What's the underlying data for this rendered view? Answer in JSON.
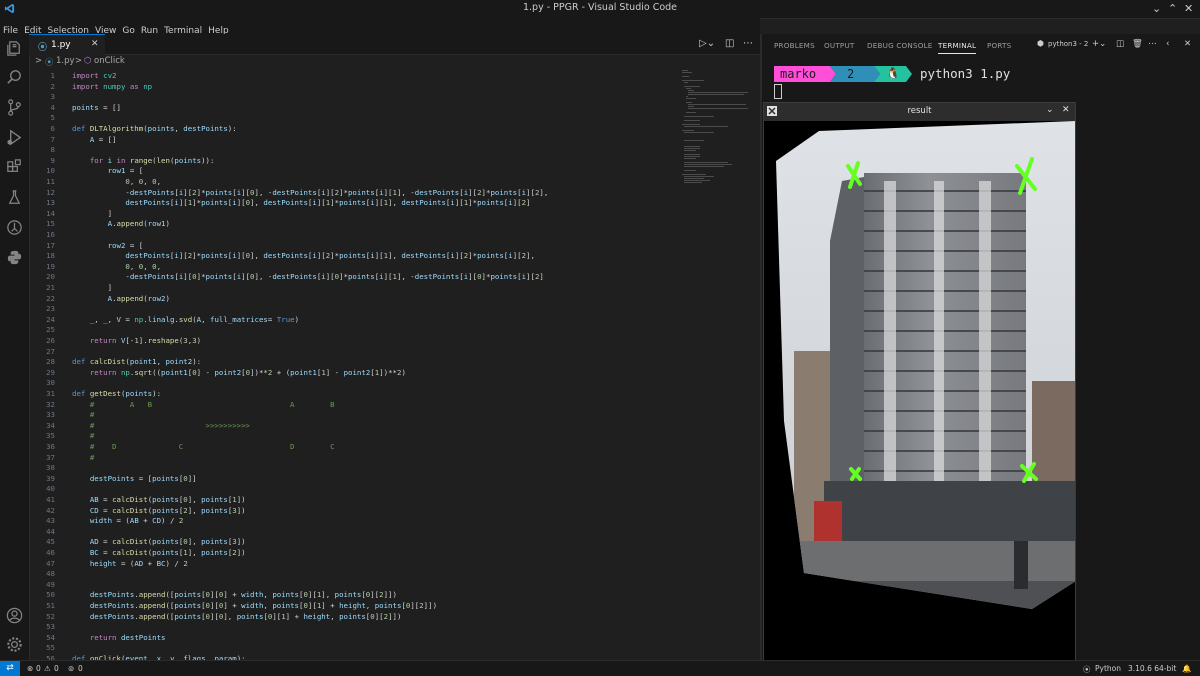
{
  "window": {
    "title": "1.py - PPGR - Visual Studio Code"
  },
  "menu": [
    "File",
    "Edit",
    "Selection",
    "View",
    "Go",
    "Run",
    "Terminal",
    "Help"
  ],
  "tab": {
    "name": "1.py",
    "icon_label": "",
    "close": "✕"
  },
  "breadcrumb": {
    "chevron": ">",
    "file": "1.py",
    "sep": ">",
    "symbol": "onClick"
  },
  "code": {
    "line_numbers": [
      "1",
      "2",
      "3",
      "4",
      "5",
      "6",
      "7",
      "8",
      "9",
      "10",
      "11",
      "12",
      "13",
      "14",
      "15",
      "16",
      "17",
      "18",
      "19",
      "20",
      "21",
      "22",
      "23",
      "24",
      "25",
      "26",
      "27",
      "28",
      "29",
      "30",
      "31",
      "32",
      "33",
      "34",
      "35",
      "36",
      "37",
      "38",
      "39",
      "40",
      "41",
      "42",
      "43",
      "44",
      "45",
      "46",
      "47",
      "48",
      "49",
      "50",
      "51",
      "52",
      "53",
      "54",
      "55",
      "56"
    ],
    "lines": [
      "import cv2",
      "import numpy as np",
      "",
      "points = []",
      "",
      "def DLTAlgorithm(points, destPoints):",
      "    A = []",
      "",
      "    for i in range(len(points)):",
      "        row1 = [",
      "            0, 0, 0,",
      "            -destPoints[i][2]*points[i][0], -destPoints[i][2]*points[i][1], -destPoints[i][2]*points[i][2],",
      "            destPoints[i][1]*points[i][0], destPoints[i][1]*points[i][1], destPoints[i][1]*points[i][2]",
      "        ]",
      "        A.append(row1)",
      "",
      "        row2 = [",
      "            destPoints[i][2]*points[i][0], destPoints[i][2]*points[i][1], destPoints[i][2]*points[i][2],",
      "            0, 0, 0,",
      "            -destPoints[i][0]*points[i][0], -destPoints[i][0]*points[i][1], -destPoints[i][0]*points[i][2]",
      "        ]",
      "        A.append(row2)",
      "",
      "    _, _, V = np.linalg.svd(A, full_matrices= True)",
      "",
      "    return V[-1].reshape(3,3)",
      "",
      "def calcDist(point1, point2):",
      "    return np.sqrt((point1[0] - point2[0])**2 + (point1[1] - point2[1])**2)",
      "",
      "def getDest(points):",
      "    #        A   B                               A        B",
      "    #",
      "    #                         >>>>>>>>>>",
      "    #",
      "    #    D              C                        D        C",
      "    #",
      "",
      "    destPoints = [points[0]]",
      "",
      "    AB = calcDist(points[0], points[1])",
      "    CD = calcDist(points[2], points[3])",
      "    width = (AB + CD) / 2",
      "",
      "    AD = calcDist(points[0], points[3])",
      "    BC = calcDist(points[1], points[2])",
      "    height = (AD + BC) / 2",
      "",
      "",
      "    destPoints.append([points[0][0] + width, points[0][1], points[0][2]])",
      "    destPoints.append([points[0][0] + width, points[0][1] + height, points[0][2]])",
      "    destPoints.append([points[0][0], points[0][1] + height, points[0][2]])",
      "",
      "    return destPoints",
      "",
      "def onClick(event, x, y, flags, param):"
    ]
  },
  "panel": {
    "tabs": [
      "PROBLEMS",
      "OUTPUT",
      "DEBUG CONSOLE",
      "TERMINAL",
      "PORTS"
    ],
    "active_tab": "TERMINAL",
    "terminal_name": "python3 - 2",
    "prompt_user": "marko",
    "prompt_num": "2",
    "command": "python3 1.py"
  },
  "result_window": {
    "title": "result",
    "minimize": "⌄",
    "close": "✕"
  },
  "status": {
    "errors": "0",
    "warnings": "0",
    "ports": "0",
    "language": "Python",
    "interpreter": "3.10.6 64-bit"
  },
  "colors": {
    "accent": "#0078d4",
    "prompt_user_bg": "#ff4fd8",
    "prompt_num_bg": "#2f8fb8",
    "prompt_icon_bg": "#25c2a0",
    "marker": "#66ff22"
  }
}
